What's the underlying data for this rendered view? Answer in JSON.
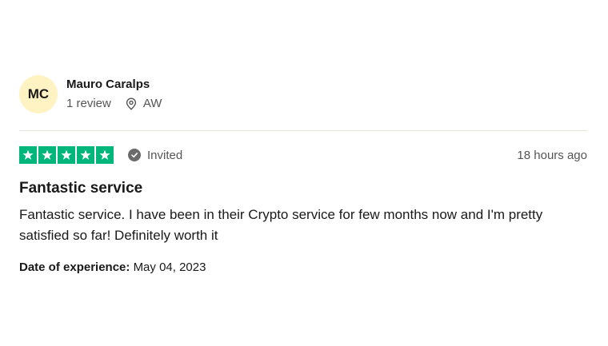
{
  "reviewer": {
    "initials": "MC",
    "name": "Mauro Caralps",
    "review_count": "1 review",
    "location": "AW",
    "avatar_color": "#fff3c4"
  },
  "rating": {
    "stars": 5,
    "star_color": "#00b67a",
    "invited_label": "Invited",
    "invited_icon": "check-circle-icon"
  },
  "timestamp": "18 hours ago",
  "review": {
    "title": "Fantastic service",
    "body": "Fantastic service. I have been in their Crypto service for few months now and I'm pretty satisfied so far! Definitely worth it"
  },
  "experience": {
    "label": "Date of experience:",
    "date": "May 04, 2023"
  }
}
